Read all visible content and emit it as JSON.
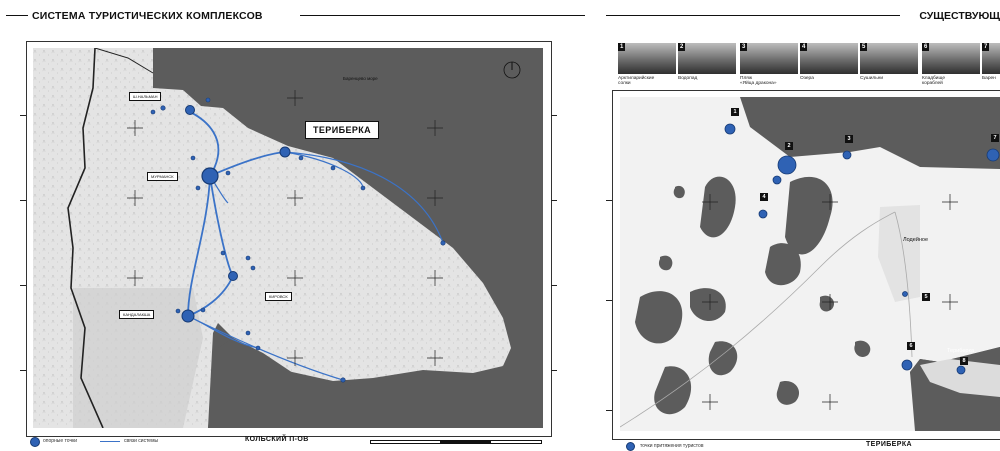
{
  "header": {
    "left_title": "СИСТЕМА ТУРИСТИЧЕСКИХ КОМПЛЕКСОВ",
    "right_title": "СУЩЕСТВУЮЩ"
  },
  "left_map": {
    "sea_label": "Баренцево море",
    "places": {
      "teriberka": "ТЕРИБЕРКА",
      "murmansk": "МУРМАНСК",
      "kandalaksha": "КАНДАЛАКША",
      "kirovsk": "КИРОВСК",
      "shalmani": "Ш.НАЛЬМАН"
    },
    "legend": {
      "points": "опорные точки",
      "links": "связи системы"
    },
    "footer_title": "КОЛЬСКИЙ П-ОВ"
  },
  "right_map": {
    "photos": [
      {
        "num": "1",
        "caption_lines": [
          "Арктиларийские",
          "солки"
        ]
      },
      {
        "num": "2",
        "caption_lines": [
          "Водопад"
        ]
      },
      {
        "num": "3",
        "caption_lines": [
          "Пляж",
          "«Яйца дракона»"
        ]
      },
      {
        "num": "4",
        "caption_lines": [
          "Озера"
        ]
      },
      {
        "num": "5",
        "caption_lines": [
          "Сушильни"
        ]
      },
      {
        "num": "6",
        "caption_lines": [
          "Кладбище",
          "кораблей"
        ]
      },
      {
        "num": "7",
        "caption_lines": [
          "Барен"
        ]
      }
    ],
    "points": [
      "1",
      "2",
      "3",
      "4",
      "5",
      "6",
      "7",
      "8"
    ],
    "places": {
      "lodeynoe": "Лодейное",
      "teriberka": "Териберка"
    },
    "legend": {
      "points": "точки притяжения туристов"
    },
    "footer_title": "ТЕРИБЕРКА"
  },
  "colors": {
    "network_blue": "#3b73c8",
    "point_blue": "#2f62b4",
    "land": "#f2f2f2",
    "water": "#5c5c5c"
  }
}
